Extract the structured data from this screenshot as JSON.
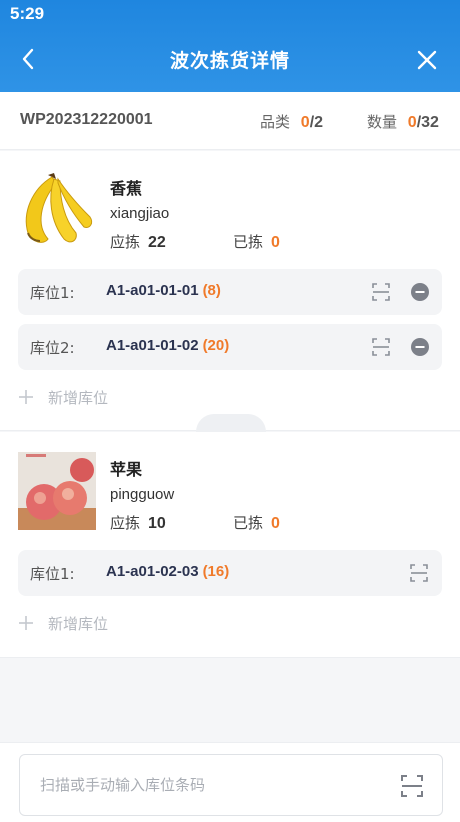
{
  "status_bar": {
    "time": "5:29"
  },
  "header": {
    "title": "波次拣货详情",
    "back_icon": "chevron-left-icon",
    "close_icon": "close-icon"
  },
  "summary": {
    "wave_no": "WP202312220001",
    "category_label": "品类",
    "category_picked": "0",
    "category_total": "/2",
    "qty_label": "数量",
    "qty_picked": "0",
    "qty_total": "/32"
  },
  "products": [
    {
      "name": "香蕉",
      "code": "xiangjiao",
      "should_label": "应拣",
      "should_value": "22",
      "picked_label": "已拣",
      "picked_value": "0",
      "image": "banana-image",
      "locations": [
        {
          "label": "库位1:",
          "code": "A1-a01-01-01",
          "count": "(8)"
        },
        {
          "label": "库位2:",
          "code": "A1-a01-01-02",
          "count": "(20)"
        }
      ],
      "add_location_label": "新增库位"
    },
    {
      "name": "苹果",
      "code": "pingguow",
      "should_label": "应拣",
      "should_value": "10",
      "picked_label": "已拣",
      "picked_value": "0",
      "image": "apple-image",
      "locations": [
        {
          "label": "库位1:",
          "code": "A1-a01-02-03",
          "count": "(16)"
        }
      ],
      "add_location_label": "新增库位"
    }
  ],
  "scan": {
    "placeholder": "扫描或手动输入库位条码",
    "value": ""
  },
  "colors": {
    "header_blue": "#2a8de4",
    "accent_orange": "#f07a2a"
  }
}
